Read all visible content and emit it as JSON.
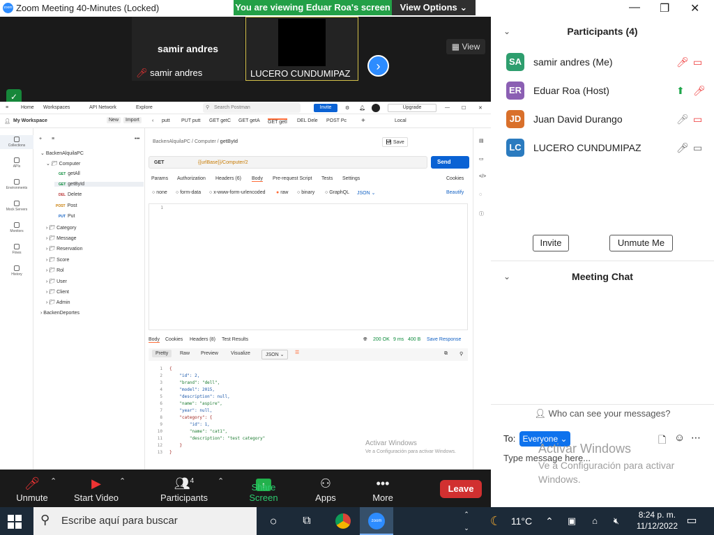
{
  "window": {
    "title": "Zoom Meeting 40-Minutes  (Locked)",
    "banner": "You are viewing Eduar Roa's screen",
    "view_options": "View Options"
  },
  "stage": {
    "tiles": [
      {
        "name": "samir andres",
        "label": "samir andres"
      },
      {
        "label": "LUCERO CUNDUMIPAZ"
      }
    ],
    "view_button": "View"
  },
  "postman": {
    "topnav": [
      "Home",
      "Workspaces",
      "API Network",
      "Explore"
    ],
    "search": "Search Postman",
    "invite": "Invite",
    "upgrade": "Upgrade",
    "workspace": "My Workspace",
    "new": "New",
    "import": "Import",
    "sidebar": [
      "Collections",
      "APIs",
      "Environments",
      "Mock Servers",
      "Monitors",
      "Flows",
      "History"
    ],
    "tree": {
      "root": "BackenAlquilaPC",
      "computer": "Computer",
      "requests": [
        {
          "method": "GET",
          "name": "getAll"
        },
        {
          "method": "GET",
          "name": "getById"
        },
        {
          "method": "DEL",
          "name": "Delete"
        },
        {
          "method": "POST",
          "name": "Post"
        },
        {
          "method": "PUT",
          "name": "Put"
        }
      ],
      "folders": [
        "Category",
        "Message",
        "Reservation",
        "Score",
        "Rol",
        "User",
        "Client",
        "Admin"
      ],
      "other": "BackenDeportes"
    },
    "tabs": [
      "putt",
      "PUT putt",
      "GET getC",
      "GET getA",
      "GET getI",
      "DEL Dele",
      "POST Pc"
    ],
    "env": "Local",
    "breadcrumb": [
      "BackenAlquilaPC",
      "Computer",
      "getById"
    ],
    "save": "Save",
    "method": "GET",
    "url": "{{urlBase}}/Computer/2",
    "send": "Send",
    "req_tabs": [
      "Params",
      "Authorization",
      "Headers (6)",
      "Body",
      "Pre-request Script",
      "Tests",
      "Settings"
    ],
    "cookies": "Cookies",
    "body_types": [
      "none",
      "form-data",
      "x-www-form-urlencoded",
      "raw",
      "binary",
      "GraphQL"
    ],
    "json": "JSON",
    "beautify": "Beautify",
    "resp_tabs": [
      "Body",
      "Cookies",
      "Headers (8)",
      "Test Results"
    ],
    "status": "200 OK",
    "time": "9 ms",
    "size": "400 B",
    "save_response": "Save Response",
    "view_tabs": [
      "Pretty",
      "Raw",
      "Preview",
      "Visualize"
    ],
    "format": "JSON",
    "response_lines": [
      "{",
      "    \"id\": 2,",
      "    \"brand\": \"dell\",",
      "    \"model\": 2015,",
      "    \"description\": null,",
      "    \"name\": \"aspire\",",
      "    \"year\": null,",
      "    \"category\": {",
      "        \"id\": 1,",
      "        \"name\": \"cat1\",",
      "        \"description\": \"test category\"",
      "    }",
      "}"
    ],
    "watermark1": "Activar Windows",
    "watermark2": "Ve a Configuración para activar Windows."
  },
  "toolbar": {
    "unmute": "Unmute",
    "start_video": "Start Video",
    "participants": "Participants",
    "participants_count": "4",
    "share": "Share Screen",
    "apps": "Apps",
    "more": "More",
    "leave": "Leave"
  },
  "participants": {
    "title": "Participants (4)",
    "list": [
      {
        "initials": "SA",
        "name": "samir andres (Me)",
        "color": "#2e9e6e"
      },
      {
        "initials": "ER",
        "name": "Eduar Roa (Host)",
        "color": "#8b5fb3"
      },
      {
        "initials": "JD",
        "name": "Juan David Durango",
        "color": "#d9702b"
      },
      {
        "initials": "LC",
        "name": "LUCERO CUNDUMIPAZ",
        "color": "#2b7bbf"
      }
    ],
    "invite": "Invite",
    "unmute_me": "Unmute Me"
  },
  "chat": {
    "title": "Meeting Chat",
    "who": "Who can see your messages?",
    "to": "To:",
    "everyone": "Everyone",
    "placeholder": "Type message here...",
    "watermark1": "Activar Windows",
    "watermark2": "Ve a Configuración para activar Windows."
  },
  "taskbar": {
    "search": "Escribe aquí para buscar",
    "temp": "11°C",
    "time": "8:24 p. m.",
    "date": "11/12/2022"
  }
}
